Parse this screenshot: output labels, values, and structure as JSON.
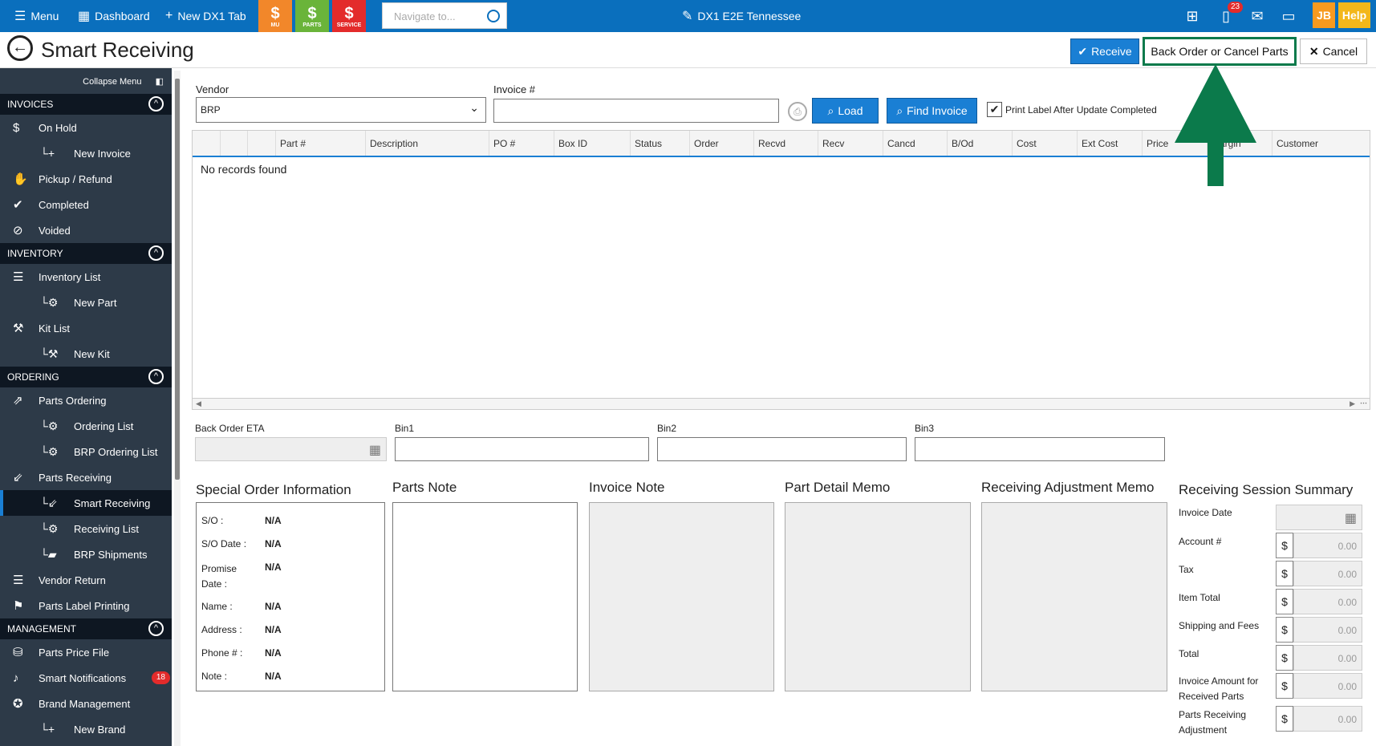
{
  "topbar": {
    "menu_label": "Menu",
    "dashboard_label": "Dashboard",
    "new_tab_label": "New DX1 Tab",
    "modules": [
      {
        "label": "MU",
        "color": "#f2872a"
      },
      {
        "label": "PARTS",
        "color": "#6ab43a"
      },
      {
        "label": "SERVICE",
        "color": "#e32b2b"
      }
    ],
    "navigate_placeholder": "Navigate to...",
    "store_title": "DX1 E2E Tennessee",
    "phone_badge": "23",
    "user_initials": "JB",
    "help_label": "Help"
  },
  "page": {
    "title": "Smart Receiving",
    "receive_label": "Receive",
    "back_order_label": "Back Order or Cancel Parts",
    "cancel_label": "Cancel"
  },
  "sidebar": {
    "collapse_label": "Collapse Menu",
    "invoices_header": "INVOICES",
    "inventory_header": "INVENTORY",
    "ordering_header": "ORDERING",
    "management_header": "MANAGEMENT",
    "items": {
      "on_hold": "On Hold",
      "new_invoice": "New Invoice",
      "pickup_refund": "Pickup / Refund",
      "completed": "Completed",
      "voided": "Voided",
      "inventory_list": "Inventory List",
      "new_part": "New Part",
      "kit_list": "Kit List",
      "new_kit": "New Kit",
      "parts_ordering": "Parts Ordering",
      "ordering_list": "Ordering List",
      "brp_ordering_list": "BRP Ordering List",
      "parts_receiving": "Parts Receiving",
      "smart_receiving": "Smart Receiving",
      "receiving_list": "Receiving List",
      "brp_shipments": "BRP Shipments",
      "vendor_return": "Vendor Return",
      "parts_label_printing": "Parts Label Printing",
      "parts_price_file": "Parts Price File",
      "smart_notifications": "Smart Notifications",
      "brand_management": "Brand Management",
      "new_brand": "New Brand"
    },
    "notifications_badge": "18"
  },
  "form": {
    "vendor_label": "Vendor",
    "vendor_value": "BRP",
    "invoice_label": "Invoice #",
    "invoice_value": "",
    "load_label": "Load",
    "find_invoice_label": "Find Invoice",
    "print_label_text": "Print Label After Update Completed",
    "print_label_checked": true
  },
  "grid": {
    "columns": [
      "Part #",
      "Description",
      "PO #",
      "Box ID",
      "Status",
      "Order",
      "Recvd",
      "Recv",
      "Cancd",
      "B/Od",
      "Cost",
      "Ext Cost",
      "Price",
      "Margin",
      "Customer"
    ],
    "empty_text": "No records found"
  },
  "bins": {
    "back_order_eta_label": "Back Order ETA",
    "bin1_label": "Bin1",
    "bin2_label": "Bin2",
    "bin3_label": "Bin3"
  },
  "special_order": {
    "title": "Special Order Information",
    "rows": [
      {
        "key": "S/O :",
        "value": "N/A"
      },
      {
        "key": "S/O Date :",
        "value": "N/A"
      },
      {
        "key": "Promise Date :",
        "value": "N/A"
      },
      {
        "key": "Name :",
        "value": "N/A"
      },
      {
        "key": "Address :",
        "value": "N/A"
      },
      {
        "key": "Phone # :",
        "value": "N/A"
      },
      {
        "key": "Note :",
        "value": "N/A"
      }
    ]
  },
  "notes": {
    "parts_note": "Parts Note",
    "invoice_note": "Invoice Note",
    "part_detail_memo": "Part Detail Memo",
    "receiving_adjustment_memo": "Receiving Adjustment Memo"
  },
  "summary": {
    "title": "Receiving Session Summary",
    "invoice_date_label": "Invoice Date",
    "currency": "$",
    "rows": [
      {
        "label": "Account #",
        "value": "0.00"
      },
      {
        "label": "Tax",
        "value": "0.00"
      },
      {
        "label": "Item Total",
        "value": "0.00"
      },
      {
        "label": "Shipping and Fees",
        "value": "0.00"
      },
      {
        "label": "Total",
        "value": "0.00"
      },
      {
        "label": "Invoice Amount for Received Parts",
        "value": "0.00"
      },
      {
        "label": "Parts Receiving Adjustment",
        "value": "0.00"
      }
    ]
  },
  "annotation": {
    "arrow_color": "#0b7a4b"
  }
}
